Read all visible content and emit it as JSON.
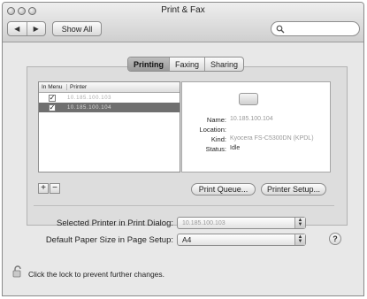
{
  "window": {
    "title": "Print & Fax",
    "show_all_label": "Show All",
    "search_placeholder": ""
  },
  "tabs": [
    {
      "label": "Printing",
      "active": true
    },
    {
      "label": "Faxing",
      "active": false
    },
    {
      "label": "Sharing",
      "active": false
    }
  ],
  "printer_list": {
    "header_in_menu": "In Menu",
    "header_printer": "Printer",
    "rows": [
      {
        "checked": true,
        "name": "10.185.100.103",
        "selected": false
      },
      {
        "checked": true,
        "name": "10.185.100.104",
        "selected": true
      }
    ]
  },
  "details": {
    "name_label": "Name:",
    "name_value": "10.185.100.104",
    "location_label": "Location:",
    "location_value": "",
    "kind_label": "Kind:",
    "kind_value": "Kyocera FS-C5300DN (KPDL)",
    "status_label": "Status:",
    "status_value": "Idle"
  },
  "buttons": {
    "add": "+",
    "remove": "−",
    "print_queue": "Print Queue...",
    "printer_setup": "Printer Setup..."
  },
  "settings": {
    "selected_printer_label": "Selected Printer in Print Dialog:",
    "selected_printer_value": "10.185.100.103",
    "paper_size_label": "Default Paper Size in Page Setup:",
    "paper_size_value": "A4"
  },
  "help_label": "?",
  "lock_message": "Click the lock to prevent further changes.",
  "colors": {
    "selected_row": "#6f6f6f",
    "panel_bg": "#dddddd"
  }
}
